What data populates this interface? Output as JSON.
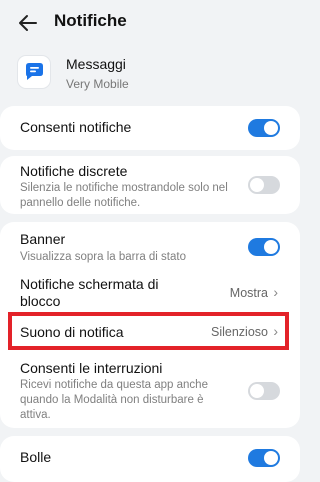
{
  "header": {
    "title": "Notifiche",
    "back_icon": "arrow-left-icon"
  },
  "app": {
    "name": "Messaggi",
    "carrier": "Very Mobile",
    "icon": "messages-app-icon"
  },
  "settings": {
    "allow_notifications": {
      "label": "Consenti notifiche",
      "enabled": true
    },
    "discreet": {
      "label": "Notifiche discrete",
      "description": "Silenzia le notifiche mostrandole solo nel pannello delle notifiche.",
      "enabled": false
    },
    "banner": {
      "label": "Banner",
      "description": "Visualizza sopra la barra di stato",
      "enabled": true
    },
    "lockscreen": {
      "label_line1": "Notifiche schermata di",
      "label_line2": "blocco",
      "value": "Mostra"
    },
    "sound": {
      "label": "Suono di notifica",
      "value": "Silenzioso"
    },
    "interruptions": {
      "label": "Consenti le interruzioni",
      "description_line1": "Ricevi notifiche da questa app anche",
      "description_line2": "quando la Modalità non disturbare è",
      "description_line3": "attiva.",
      "enabled": false
    },
    "bubbles": {
      "label": "Bolle",
      "enabled": true
    }
  },
  "colors": {
    "accent": "#1f7ae0",
    "highlight": "#e32229",
    "background": "#f1f3f5"
  }
}
